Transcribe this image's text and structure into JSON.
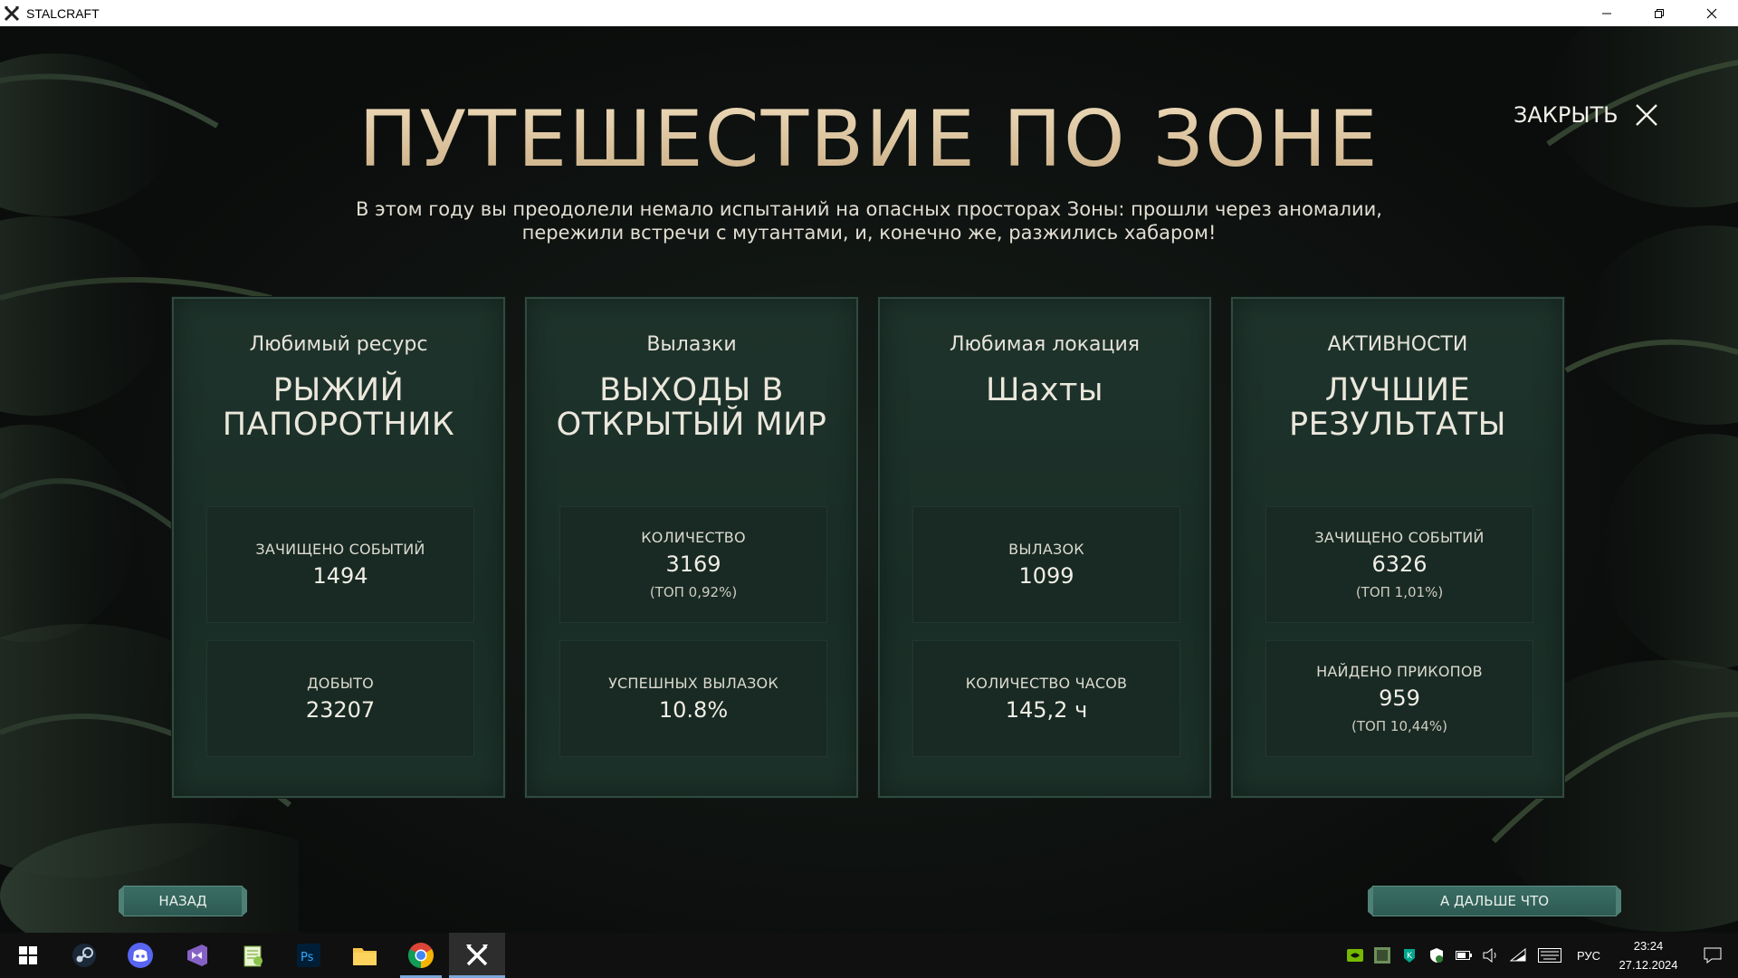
{
  "window": {
    "title": "STALCRAFT"
  },
  "page": {
    "title": "ПУТЕШЕСТВИЕ ПО ЗОНЕ",
    "subtitle_line1": "В этом году вы преодолели немало испытаний на опасных просторах Зоны: прошли через аномалии,",
    "subtitle_line2": "пережили встречи с мутантами, и, конечно же, разжились хабаром!",
    "close_label": "ЗАКРЫТЬ"
  },
  "cards": [
    {
      "label": "Любимый ресурс",
      "value_line1": "РЫЖИЙ",
      "value_line2": "ПАПОРОТНИК",
      "stats": [
        {
          "label": "ЗАЧИЩЕНО СОБЫТИЙ",
          "value": "1494",
          "sub": ""
        },
        {
          "label": "ДОБЫТО",
          "value": "23207",
          "sub": ""
        }
      ]
    },
    {
      "label": "Вылазки",
      "value_line1": "ВЫХОДЫ В",
      "value_line2": "ОТКРЫТЫЙ МИР",
      "stats": [
        {
          "label": "КОЛИЧЕСТВО",
          "value": "3169",
          "sub": "(ТОП 0,92%)"
        },
        {
          "label": "УСПЕШНЫХ ВЫЛАЗОК",
          "value": "10.8%",
          "sub": ""
        }
      ]
    },
    {
      "label": "Любимая локация",
      "value_line1": "Шахты",
      "value_line2": "",
      "stats": [
        {
          "label": "ВЫЛАЗОК",
          "value": "1099",
          "sub": ""
        },
        {
          "label": "КОЛИЧЕСТВО ЧАСОВ",
          "value": "145,2 ч",
          "sub": ""
        }
      ]
    },
    {
      "label": "АКТИВНОСТИ",
      "value_line1": "ЛУЧШИЕ",
      "value_line2": "РЕЗУЛЬТАТЫ",
      "stats": [
        {
          "label": "ЗАЧИЩЕНО СОБЫТИЙ",
          "value": "6326",
          "sub": "(ТОП 1,01%)"
        },
        {
          "label": "НАЙДЕНО ПРИКОПОВ",
          "value": "959",
          "sub": "(ТОП 10,44%)"
        }
      ]
    }
  ],
  "buttons": {
    "back_label": "НАЗАД",
    "next_label": "А ДАЛЬШЕ ЧТО"
  },
  "taskbar": {
    "apps": [
      "start-icon",
      "steam-icon",
      "discord-icon",
      "visual-studio-icon",
      "notepad-plus-icon",
      "photoshop-icon",
      "file-explorer-icon",
      "chrome-icon",
      "stalcraft-icon"
    ],
    "photoshop_text": "Ps",
    "language": "РУС",
    "time": "23:24",
    "date": "27.12.2024"
  }
}
